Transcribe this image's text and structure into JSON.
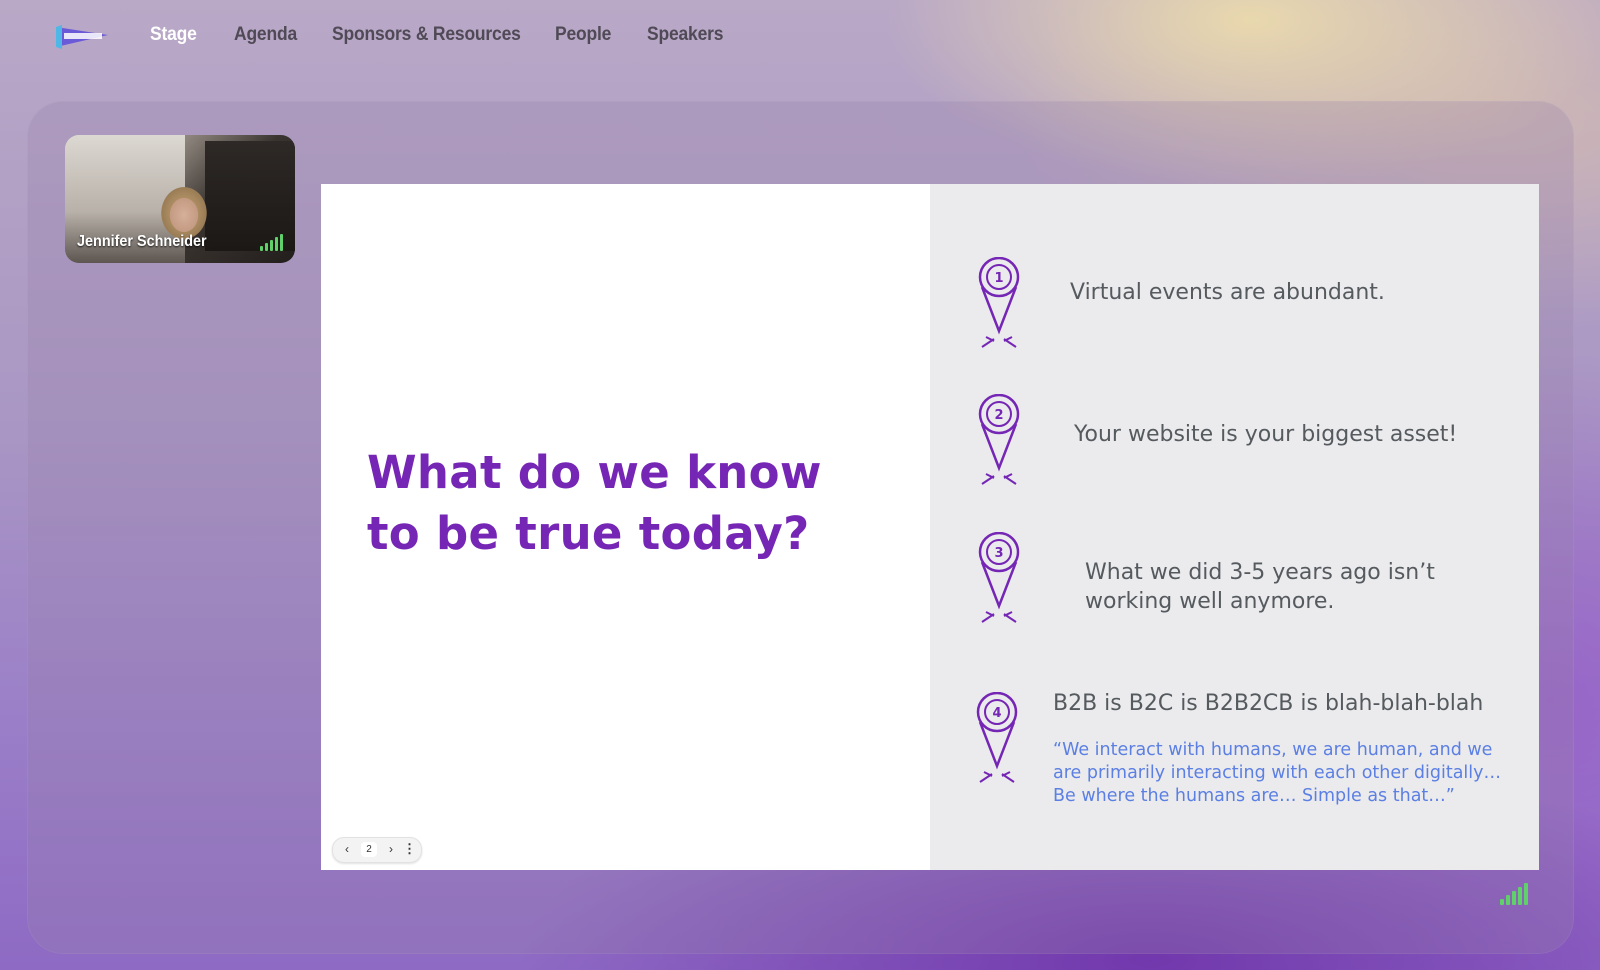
{
  "navbar": {
    "items": [
      {
        "label": "Stage",
        "active": true
      },
      {
        "label": "Agenda",
        "active": false
      },
      {
        "label": "Sponsors & Resources",
        "active": false
      },
      {
        "label": "People",
        "active": false
      },
      {
        "label": "Speakers",
        "active": false
      }
    ]
  },
  "speaker": {
    "name": "Jennifer Schneider",
    "signal_bars": 5
  },
  "slide": {
    "title": "What do we know to be true today?",
    "points": [
      {
        "number": "1",
        "text": "Virtual events are abundant."
      },
      {
        "number": "2",
        "text": "Your website is your biggest asset!"
      },
      {
        "number": "3",
        "text_line1": "What we did 3-5 years ago isn’t",
        "text_line2": "working well anymore."
      },
      {
        "number": "4",
        "text": "B2B is B2C is B2B2CB is blah-blah-blah",
        "quote_line1": "“We interact with humans, we are human, and we",
        "quote_line2": "are primarily interacting with each other digitally…",
        "quote_line3": "Be where the humans are… Simple as that…”"
      }
    ],
    "toolbar": {
      "prev": "‹",
      "page": "2",
      "next": "›",
      "more": "⋮"
    }
  },
  "stage": {
    "signal_bars": 5
  },
  "colors": {
    "accent": "#7526b5",
    "quote": "#5b7fe3",
    "signal": "#5fd06a",
    "active_nav": "#ffffff"
  }
}
